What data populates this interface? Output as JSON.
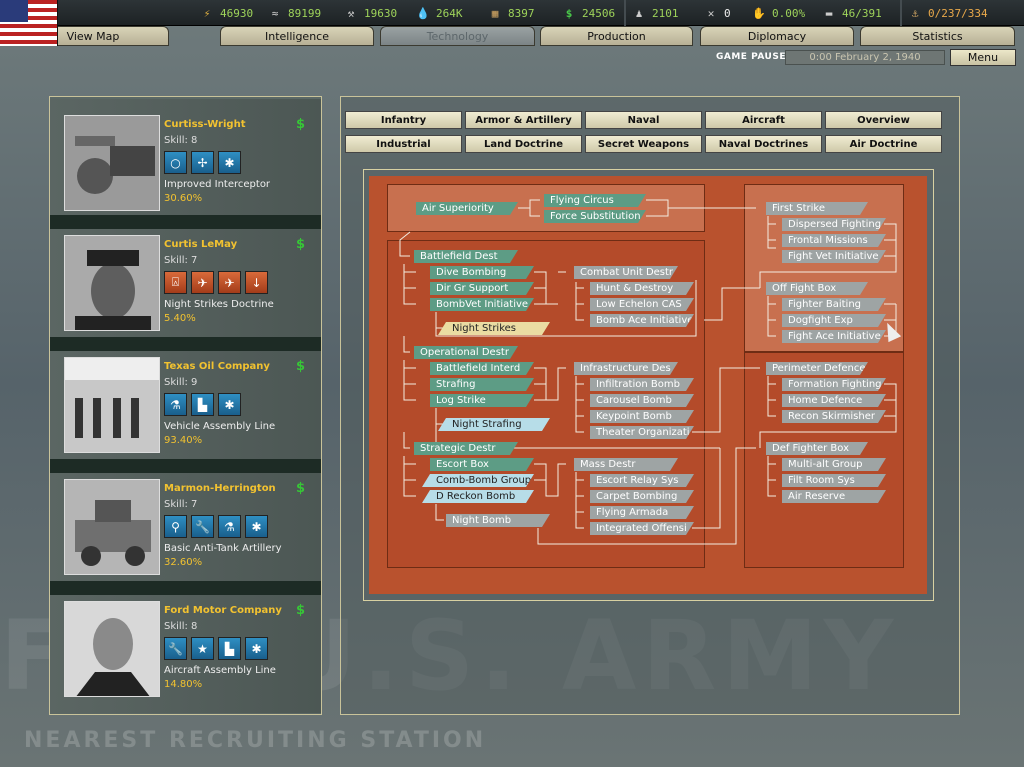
{
  "resources": {
    "energy": "46930",
    "metal": "89199",
    "rare_materials": "19630",
    "oil": "264K",
    "supplies": "8397",
    "money": "24506",
    "manpower": "2101",
    "dissent": "0",
    "research_bonus": "0.00%",
    "transports": "46/391",
    "convoys": "0/237/334"
  },
  "nav": {
    "tabs": [
      "View Map",
      "Intelligence",
      "Technology",
      "Production",
      "Diplomacy",
      "Statistics"
    ],
    "active": "Technology"
  },
  "status": {
    "paused": "GAME PAUSED",
    "date": "0:00 February 2, 1940",
    "menu": "Menu"
  },
  "teams": [
    {
      "name": "Curtiss-Wright",
      "skill": "Skill: 8",
      "project": "Improved Interceptor",
      "progress": "30.60%",
      "money": "$"
    },
    {
      "name": "Curtis LeMay",
      "skill": "Skill: 7",
      "project": "Night Strikes Doctrine",
      "progress": "5.40%",
      "money": "$"
    },
    {
      "name": "Texas Oil Company",
      "skill": "Skill: 9",
      "project": "Vehicle Assembly Line",
      "progress": "93.40%",
      "money": "$"
    },
    {
      "name": "Marmon-Herrington",
      "skill": "Skill: 7",
      "project": "Basic Anti-Tank Artillery",
      "progress": "32.60%",
      "money": "$"
    },
    {
      "name": "Ford Motor Company",
      "skill": "Skill: 8",
      "project": "Aircraft Assembly Line",
      "progress": "14.80%",
      "money": "$"
    }
  ],
  "categories_row1": [
    "Infantry",
    "Armor & Artillery",
    "Naval",
    "Aircraft",
    "Overview"
  ],
  "categories_row2": [
    "Industrial",
    "Land Doctrine",
    "Secret Weapons",
    "Naval Doctrines",
    "Air Doctrine"
  ],
  "tree": {
    "air_superiority": "Air Superiority",
    "flying_circus": "Flying Circus",
    "force_substitution": "Force Substitution",
    "battlefield_dest": "Battlefield Dest",
    "dive_bombing": "Dive Bombing",
    "dir_gr_support": "Dir Gr Support",
    "bombvet_initiative": "BombVet Initiative",
    "night_strikes": "Night Strikes",
    "combat_unit_destr": "Combat Unit Destr",
    "hunt_destroy": "Hunt & Destroy",
    "low_echelon_cas": "Low Echelon CAS",
    "bomb_ace_initiative": "Bomb Ace Initiative",
    "operational_destr": "Operational Destr",
    "battlefield_interd": "Battlefield Interd",
    "strafing": "Strafing",
    "log_strike": "Log Strike",
    "night_strafing": "Night Strafing",
    "infrastructure_des": "Infrastructure Des",
    "infiltration_bomb": "Infiltration Bomb",
    "carousel_bomb": "Carousel Bomb",
    "keypoint_bomb": "Keypoint Bomb",
    "theater_organizati": "Theater Organizati",
    "strategic_destr": "Strategic Destr",
    "escort_box": "Escort Box",
    "comb_bomb_groups": "Comb-Bomb Groups",
    "d_reckon_bomb": "D Reckon Bomb",
    "night_bomb": "Night Bomb",
    "mass_destr": "Mass Destr",
    "escort_relay_sys": "Escort Relay Sys",
    "carpet_bombing": "Carpet Bombing",
    "flying_armada": "Flying Armada",
    "integrated_offensi": "Integrated Offensi",
    "first_strike": "First Strike",
    "dispersed_fighting": "Dispersed Fighting",
    "frontal_missions": "Frontal Missions",
    "fight_vet_initiative": "Fight Vet Initiative",
    "off_fight_box": "Off Fight Box",
    "fighter_baiting": "Fighter Baiting",
    "dogfight_exp": "Dogfight Exp",
    "fight_ace_initiative": "Fight Ace Initiative",
    "perimeter_defence": "Perimeter Defence",
    "formation_fighting": "Formation Fighting",
    "home_defence": "Home Defence",
    "recon_skirmisher": "Recon Skirmisher",
    "def_fighter_box": "Def Fighter Box",
    "multi_alt_group": "Multi-alt Group",
    "filt_room_sys": "Filt Room Sys",
    "air_reserve": "Air Reserve"
  },
  "background": {
    "poster_text": "FOR U.S. ARMY",
    "recruiting": "NEAREST RECRUITING STATION"
  }
}
